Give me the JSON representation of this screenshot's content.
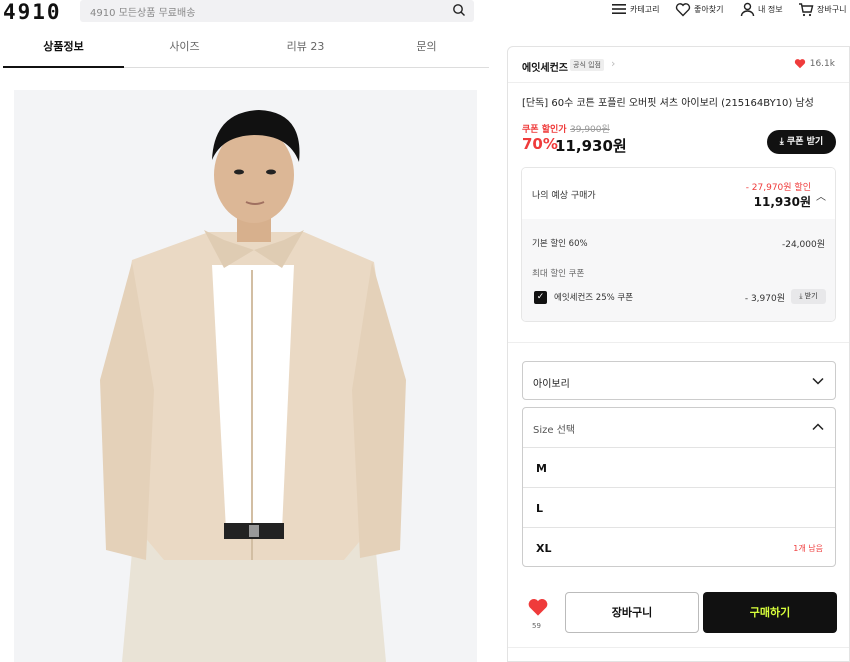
{
  "header": {
    "logo": "4910",
    "search_placeholder": "4910 모든상품 무료배송",
    "nav": [
      {
        "label": "카테고리",
        "icon": "menu-icon"
      },
      {
        "label": "좋아찾기",
        "icon": "heart-outline-icon"
      },
      {
        "label": "내 정보",
        "icon": "user-icon"
      },
      {
        "label": "장바구니",
        "icon": "cart-icon"
      }
    ]
  },
  "tabs": [
    {
      "label": "상품정보",
      "active": true
    },
    {
      "label": "사이즈",
      "active": false
    },
    {
      "label": "리뷰 23",
      "active": false
    },
    {
      "label": "문의",
      "active": false
    }
  ],
  "product": {
    "brand": "에잇세컨즈",
    "official_badge": "공식 입점",
    "likes": "16.1k",
    "name": "[단독] 60수 코튼 포플린 오버핏 셔츠 아이보리 (215164BY10) 남성",
    "coupon_label": "쿠폰 할인가",
    "original_price": "39,900원",
    "discount_rate": "70%",
    "price": "11,930원",
    "coupon_button": "쿠폰 받기"
  },
  "estimate": {
    "label": "나의 예상 구매가",
    "discount_total": "- 27,970원 할인",
    "price": "11,930원",
    "base_discount_label": "기본 할인 60%",
    "base_discount_value": "-24,000원",
    "max_coupon_label": "최대 할인 쿠폰",
    "coupon_name": "에잇세컨즈 25% 쿠폰",
    "coupon_value": "- 3,970원",
    "coupon_get": "받기"
  },
  "options": {
    "color_value": "아이보리",
    "size_placeholder": "Size 선택",
    "sizes": [
      {
        "label": "M",
        "stock": ""
      },
      {
        "label": "L",
        "stock": ""
      },
      {
        "label": "XL",
        "stock": "1개 남음"
      }
    ]
  },
  "actions": {
    "like_count": "59",
    "cart_label": "장바구니",
    "buy_label": "구매하기"
  },
  "colors": {
    "accent_red": "#ef3b3b",
    "buy_text": "#d8ff3c",
    "dark": "#111111"
  }
}
